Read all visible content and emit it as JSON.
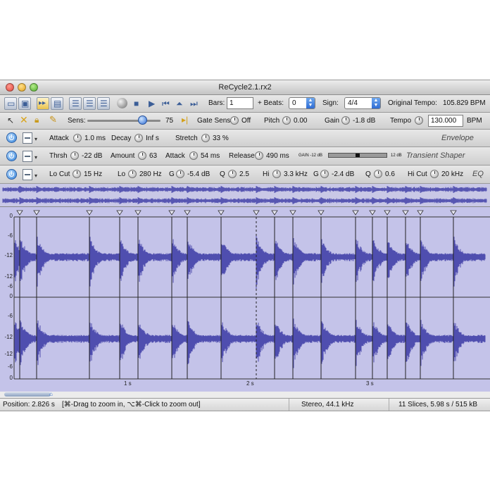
{
  "window": {
    "title": "ReCycle2.1.rx2"
  },
  "toolbar": {
    "bars_label": "Bars:",
    "bars_value": "1",
    "beats_label": "+ Beats:",
    "beats_value": "0",
    "sign_label": "Sign:",
    "sign_value": "4/4",
    "orig_tempo_label": "Original Tempo:",
    "orig_tempo_value": "105.829 BPM"
  },
  "controls": {
    "sens_label": "Sens:",
    "sens_value": "75",
    "sens_fraction": 0.75,
    "gate_label": "Gate Sens",
    "gate_value": "Off",
    "pitch_label": "Pitch",
    "pitch_value": "0.00",
    "gain_label": "Gain",
    "gain_value": "-1.8 dB",
    "tempo_label": "Tempo",
    "tempo_value": "130.000",
    "tempo_unit": "BPM"
  },
  "envelope": {
    "attack_label": "Attack",
    "attack_value": "1.0 ms",
    "decay_label": "Decay",
    "decay_value": "Inf s",
    "stretch_label": "Stretch",
    "stretch_value": "33 %",
    "panel_name": "Envelope"
  },
  "transient": {
    "thrsh_label": "Thrsh",
    "thrsh_value": "-22 dB",
    "amount_label": "Amount",
    "amount_value": "63",
    "attack_label": "Attack",
    "attack_value": "54 ms",
    "release_label": "Release",
    "release_value": "490 ms",
    "meter_left": "GAIN -12 dB",
    "meter_right": "12 dB",
    "panel_name": "Transient Shaper"
  },
  "eq": {
    "locut_label": "Lo Cut",
    "locut_value": "15 Hz",
    "lo_label": "Lo",
    "lo_value": "280 Hz",
    "lo_g_label": "G",
    "lo_g_value": "-5.4 dB",
    "lo_q_label": "Q",
    "lo_q_value": "2.5",
    "hi_label": "Hi",
    "hi_value": "3.3 kHz",
    "hi_g_label": "G",
    "hi_g_value": "-2.4 dB",
    "hi_q_label": "Q",
    "hi_q_value": "0.6",
    "hicut_label": "Hi Cut",
    "hicut_value": "20 kHz",
    "panel_name": "EQ"
  },
  "ruler": {
    "labels": [
      "0",
      "-6",
      "-12",
      "-12",
      "-6",
      "0",
      "-6",
      "-12",
      "-12",
      "-6",
      "0"
    ]
  },
  "time_ruler": {
    "labels": [
      "1 s",
      "2 s",
      "3 s"
    ]
  },
  "status": {
    "position": "Position: 2.826 s",
    "hint": "[⌘-Drag to zoom in, ⌥⌘-Click to zoom out]",
    "format": "Stereo, 44.1 kHz",
    "summary": "11 Slices, 5.98 s / 515 kB"
  },
  "colors": {
    "waveform": "#3b3aa6",
    "waveform_bg": "#c4c3e9",
    "accent": "#2f6cd3"
  }
}
